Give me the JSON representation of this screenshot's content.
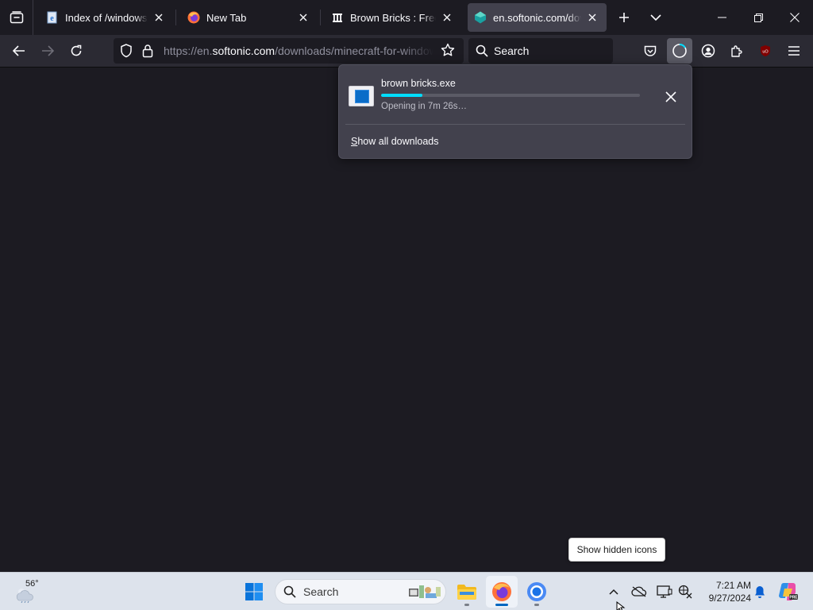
{
  "browser": {
    "tabs": [
      {
        "title": "Index of /windows/server",
        "favicon": "ie-page-icon",
        "active": false
      },
      {
        "title": "New Tab",
        "favicon": "firefox-icon",
        "active": false
      },
      {
        "title": "Brown Bricks : Free Download",
        "favicon": "archive-org-icon",
        "active": false
      },
      {
        "title": "en.softonic.com/downloads/minecraft",
        "favicon": "softonic-icon",
        "active": true
      }
    ],
    "url": {
      "prefix": "https://en.",
      "domain": "softonic.com",
      "path": "/downloads/minecraft-for-windows"
    },
    "search_placeholder": "Search"
  },
  "downloads_panel": {
    "file_name": "brown bricks.exe",
    "status": "Opening in 7m 26s…",
    "progress": 0.16,
    "show_all_prefix": "S",
    "show_all_rest": "how all downloads"
  },
  "tooltip": "Show hidden icons",
  "taskbar": {
    "weather_temp": "56°",
    "search_placeholder": "Search",
    "time": "7:21 AM",
    "date": "9/27/2024"
  },
  "colors": {
    "accent": "#00ddff",
    "page_bg": "#1c1b22",
    "toolbar_bg": "#2b2a33",
    "panel_bg": "#42414d",
    "taskbar_bg": "#dde3ec"
  }
}
